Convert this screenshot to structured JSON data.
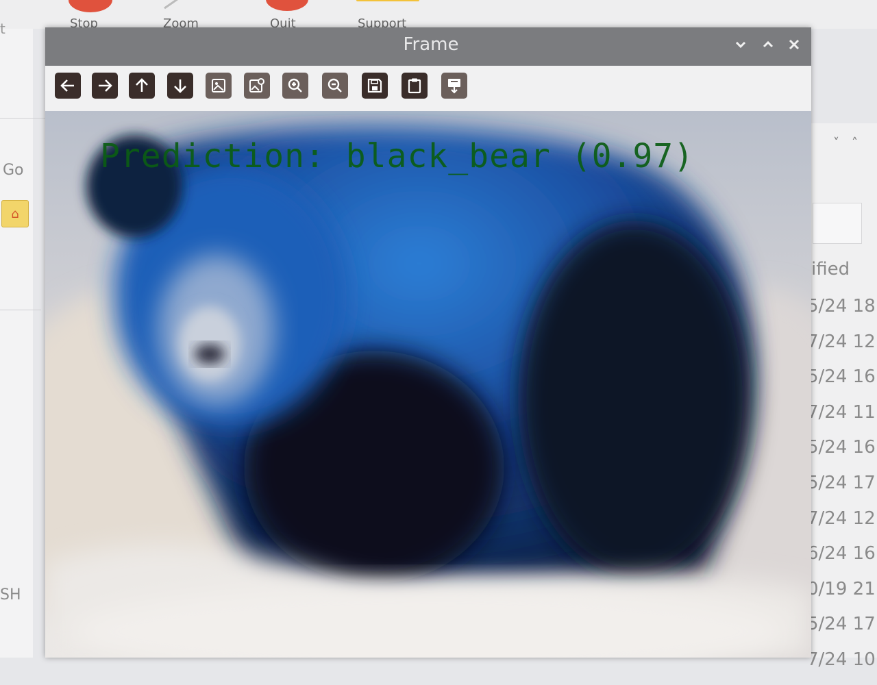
{
  "background_app": {
    "toolbar": [
      {
        "label": "Stop",
        "color": "#e0523d"
      },
      {
        "label": "Zoom",
        "color": ""
      },
      {
        "label": "Quit",
        "color": "#e0523d"
      },
      {
        "label": "Support",
        "color": "#f3c23a"
      }
    ],
    "left_stub": "t",
    "go_label": "Go",
    "home_icon": "home-icon",
    "shell_label": "SH",
    "column_header": "ified",
    "dates": [
      "5/24 18",
      "7/24 12",
      "5/24 16",
      "7/24 11",
      "5/24 16",
      "5/24 17",
      "7/24 12",
      "6/24 16",
      "0/19 21",
      "5/24 17",
      "7/24 10"
    ]
  },
  "frame_window": {
    "title": "Frame",
    "controls": [
      "chevron-down-icon",
      "chevron-up-icon",
      "close-icon"
    ],
    "toolbar_icons": [
      "arrow-left-icon",
      "arrow-right-icon",
      "arrow-up-icon",
      "arrow-down-icon",
      "image-icon",
      "image-settings-icon",
      "zoom-in-icon",
      "zoom-out-icon",
      "save-icon",
      "clipboard-icon",
      "copy-image-icon"
    ],
    "overlay_text": "Prediction: black_bear (0.97)",
    "overlay_color": "#0b5d14"
  }
}
